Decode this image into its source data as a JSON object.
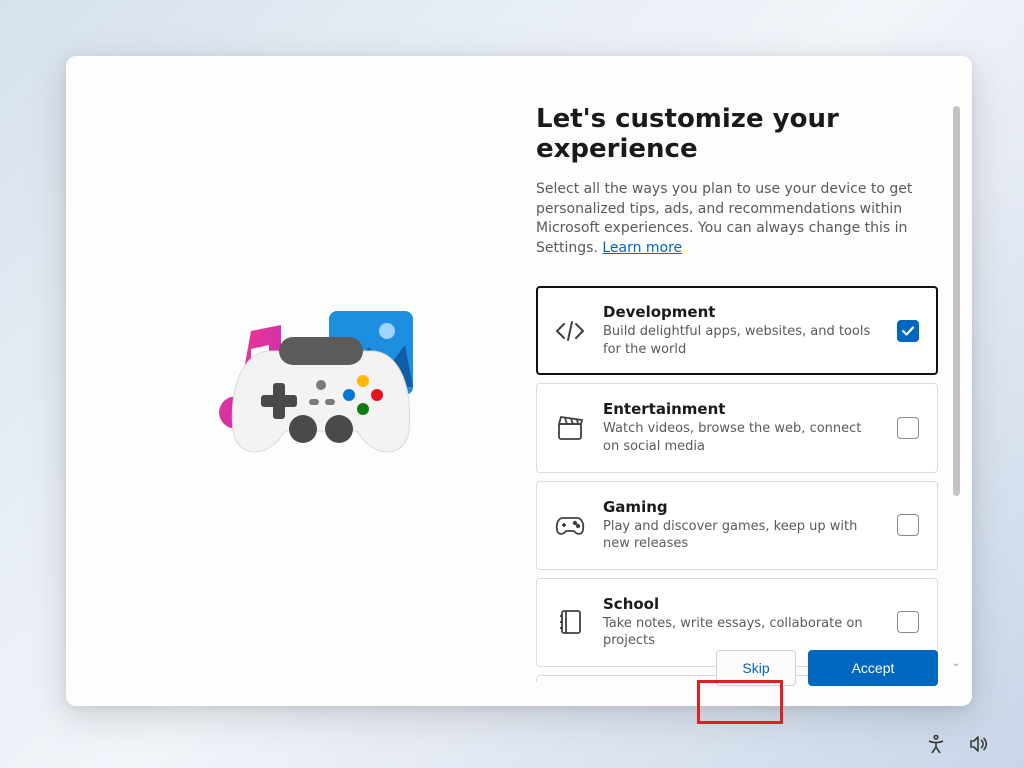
{
  "heading": "Let's customize your experience",
  "subtitle_text": "Select all the ways you plan to use your device to get personalized tips, ads, and recommendations within Microsoft experiences. You can always change this in Settings. ",
  "learn_more": "Learn more",
  "options": [
    {
      "title": "Development",
      "desc": "Build delightful apps, websites, and tools for the world",
      "checked": true
    },
    {
      "title": "Entertainment",
      "desc": "Watch videos, browse the web, connect on social media",
      "checked": false
    },
    {
      "title": "Gaming",
      "desc": "Play and discover games, keep up with new releases",
      "checked": false
    },
    {
      "title": "School",
      "desc": "Take notes, write essays, collaborate on projects",
      "checked": false
    }
  ],
  "buttons": {
    "skip": "Skip",
    "accept": "Accept"
  },
  "colors": {
    "accent": "#0067c0",
    "highlight": "#e02020"
  }
}
